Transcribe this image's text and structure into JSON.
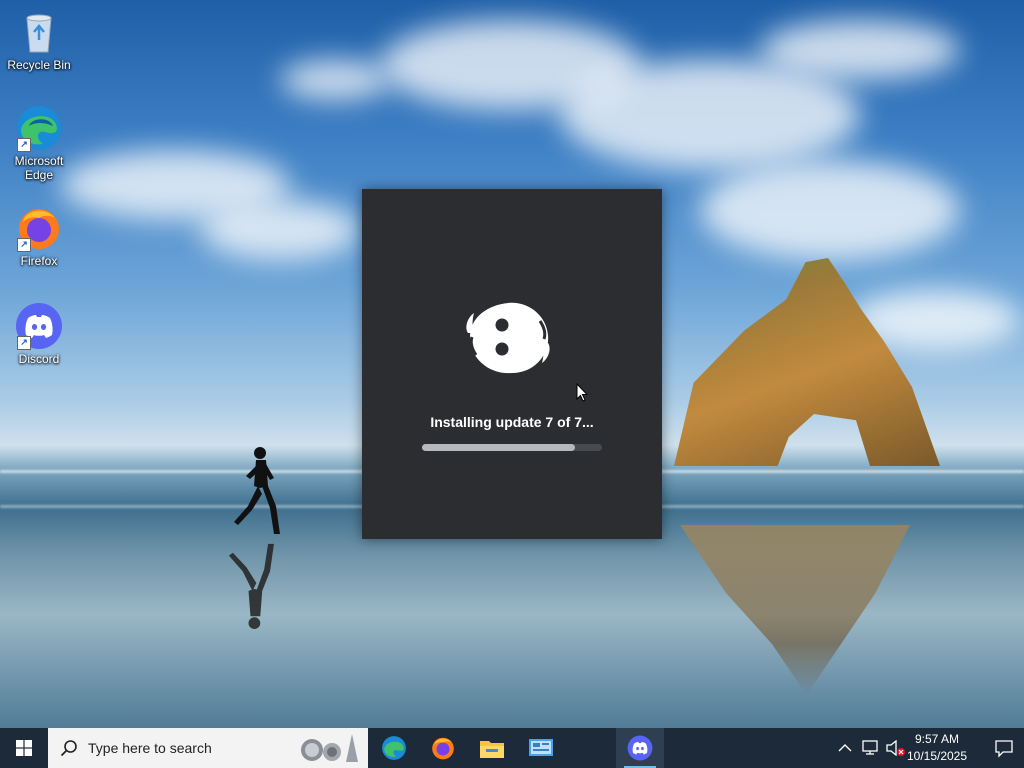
{
  "desktop": {
    "icons": [
      {
        "label": "Recycle Bin",
        "icon": "recycle-bin-icon"
      },
      {
        "label": "Microsoft Edge",
        "icon": "edge-icon"
      },
      {
        "label": "Firefox",
        "icon": "firefox-icon"
      },
      {
        "label": "Discord",
        "icon": "discord-icon"
      }
    ]
  },
  "splash": {
    "status_text": "Installing update 7 of 7...",
    "progress_fraction": 0.85,
    "colors": {
      "background": "#2b2d31",
      "track": "#474a50",
      "fill": "#b5b8bd"
    }
  },
  "taskbar": {
    "search_placeholder": "Type here to search",
    "apps": [
      {
        "name": "Microsoft Edge",
        "icon": "edge-icon"
      },
      {
        "name": "Firefox",
        "icon": "firefox-icon"
      },
      {
        "name": "File Explorer",
        "icon": "folder-icon"
      },
      {
        "name": "Control Panel",
        "icon": "control-panel-icon"
      },
      {
        "name": "Discord",
        "icon": "discord-icon",
        "active": true
      }
    ],
    "clock": {
      "time": "9:57 AM",
      "date": "10/15/2025"
    },
    "colors": {
      "taskbar": "#1c2a39",
      "accent": "#76b9ed"
    }
  }
}
